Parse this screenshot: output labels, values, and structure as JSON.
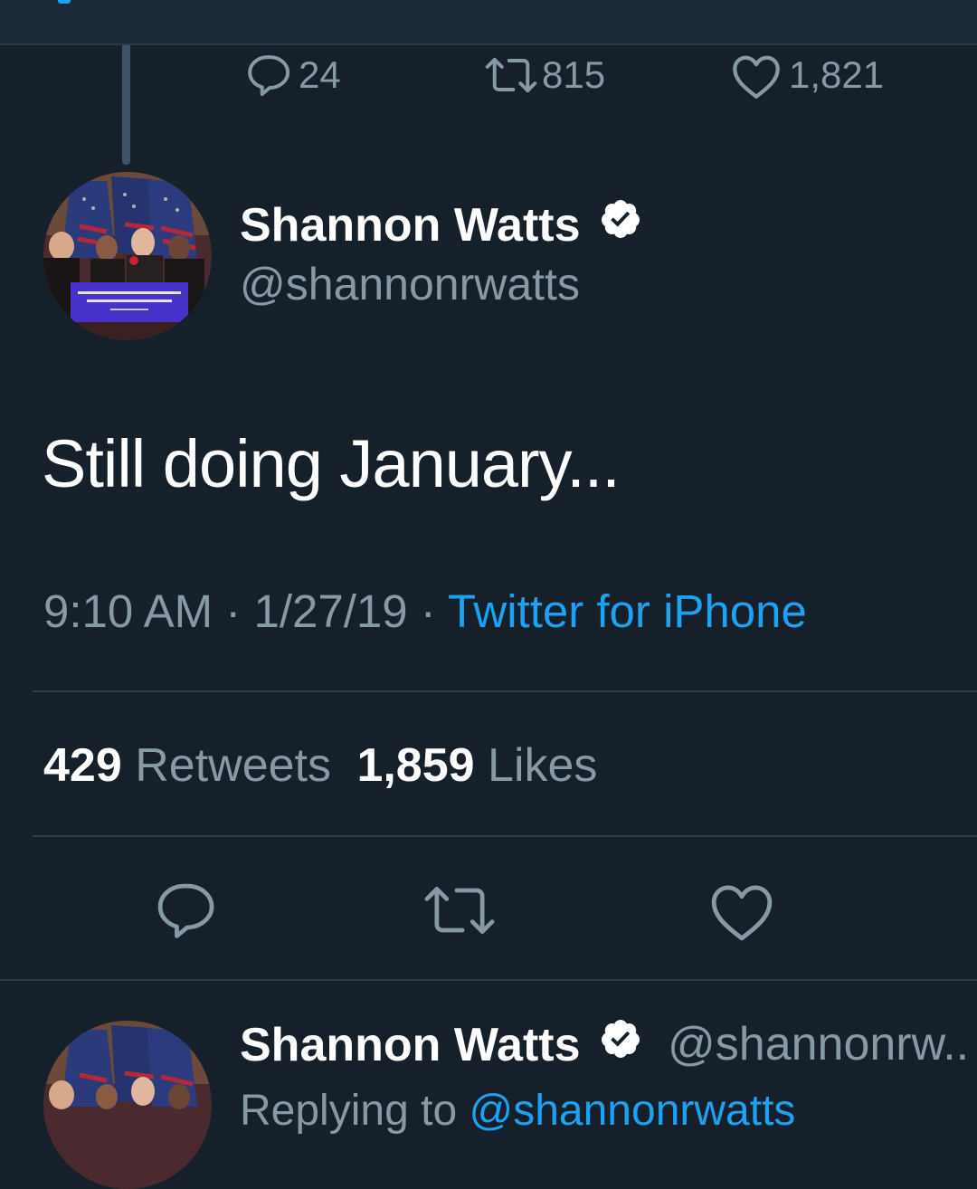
{
  "previous_tweet": {
    "reply_count": "24",
    "retweet_count": "815",
    "like_count": "1,821"
  },
  "tweet": {
    "display_name": "Shannon Watts",
    "handle": "@shannonrwatts",
    "text": "Still doing January...",
    "time": "9:10 AM",
    "date": "1/27/19",
    "separator": "·",
    "source": "Twitter for iPhone",
    "retweets_count": "429",
    "retweets_label": "Retweets",
    "likes_count": "1,859",
    "likes_label": "Likes"
  },
  "next_tweet": {
    "display_name": "Shannon Watts",
    "handle": "@shannonrw..",
    "reply_prefix": "Replying to",
    "reply_mention": "@shannonrwatts"
  },
  "icons": {
    "reply": "reply-icon",
    "retweet": "retweet-icon",
    "like": "heart-icon",
    "verified": "verified-badge-icon"
  },
  "colors": {
    "background": "#15202b",
    "secondary_text": "#8899a6",
    "link": "#1da1f2",
    "primary_text": "#ffffff"
  }
}
